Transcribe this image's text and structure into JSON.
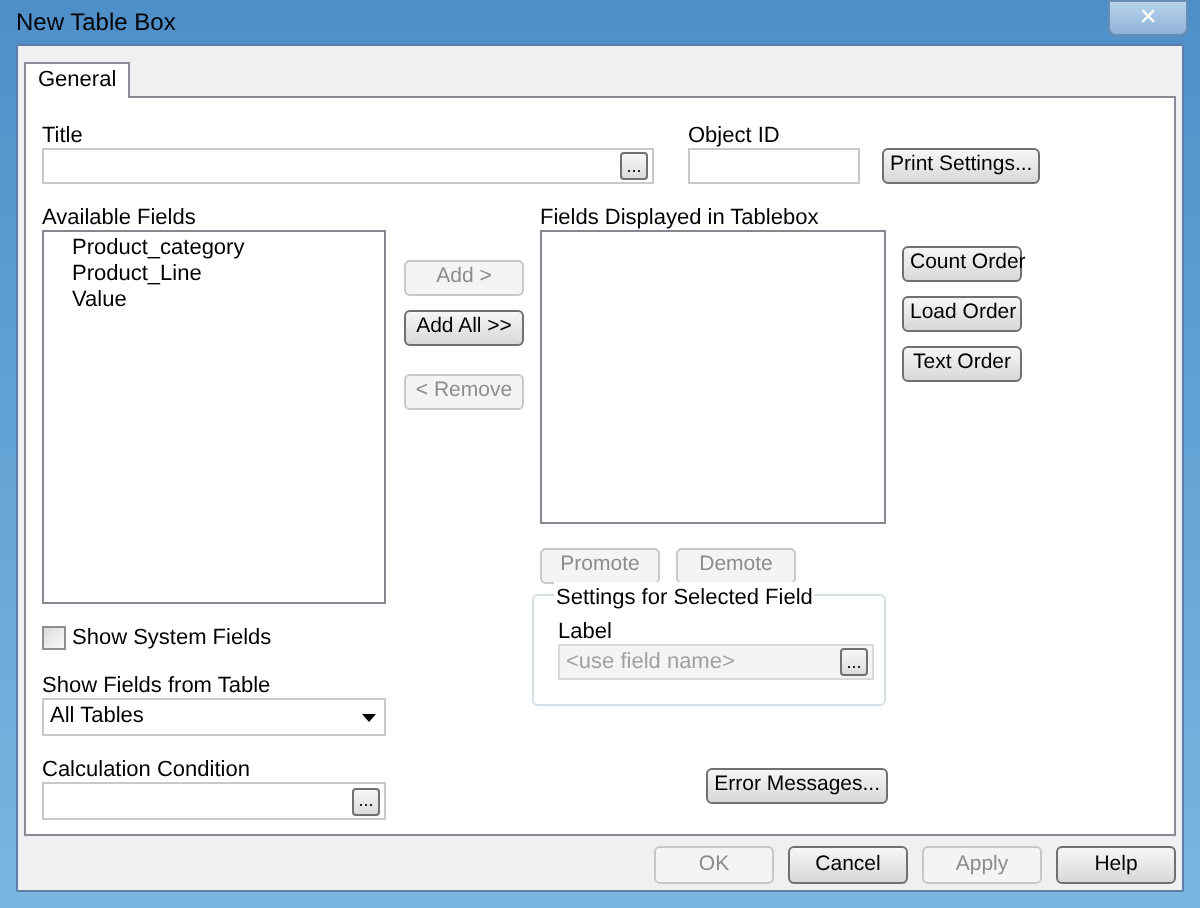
{
  "window": {
    "title": "New Table Box",
    "close": "✕"
  },
  "tabs": [
    {
      "label": "General",
      "selected": true
    }
  ],
  "title_field": {
    "label": "Title",
    "browse": "..."
  },
  "object_id": {
    "label": "Object ID"
  },
  "print_settings": {
    "label": "Print Settings...",
    "disabled": false
  },
  "available_fields": {
    "label": "Available Fields",
    "items": [
      {
        "label": "Product_category",
        "selected": false
      },
      {
        "label": "Product_Line",
        "selected": false
      },
      {
        "label": "Value",
        "selected": false
      }
    ]
  },
  "transfer_buttons": [
    {
      "label": "Add >",
      "disabled": true
    },
    {
      "label": "Add All >>",
      "disabled": false
    },
    {
      "label": "< Remove",
      "disabled": true
    }
  ],
  "displayed_fields": {
    "label": "Fields Displayed in Tablebox"
  },
  "order_buttons": [
    {
      "label": "Count Order",
      "disabled": false
    },
    {
      "label": "Load Order",
      "disabled": false
    },
    {
      "label": "Text Order",
      "disabled": false
    }
  ],
  "move_buttons": [
    {
      "label": "Promote",
      "disabled": true
    },
    {
      "label": "Demote",
      "disabled": true
    }
  ],
  "selected_field_settings": {
    "title": "Settings for Selected Field",
    "label": "Label",
    "placeholder": "<use field name>",
    "browse": "...",
    "disabled": true
  },
  "show_system_fields": {
    "label": "Show System Fields",
    "checked": false
  },
  "show_fields_from_table": {
    "label": "Show Fields from Table",
    "value": "All Tables"
  },
  "calculation_condition": {
    "label": "Calculation Condition",
    "browse": "..."
  },
  "error_messages": {
    "label": "Error Messages...",
    "disabled": false
  },
  "dialog_buttons": [
    {
      "label": "OK",
      "disabled": true
    },
    {
      "label": "Cancel",
      "disabled": false
    },
    {
      "label": "Apply",
      "disabled": true
    },
    {
      "label": "Help",
      "disabled": false
    }
  ]
}
